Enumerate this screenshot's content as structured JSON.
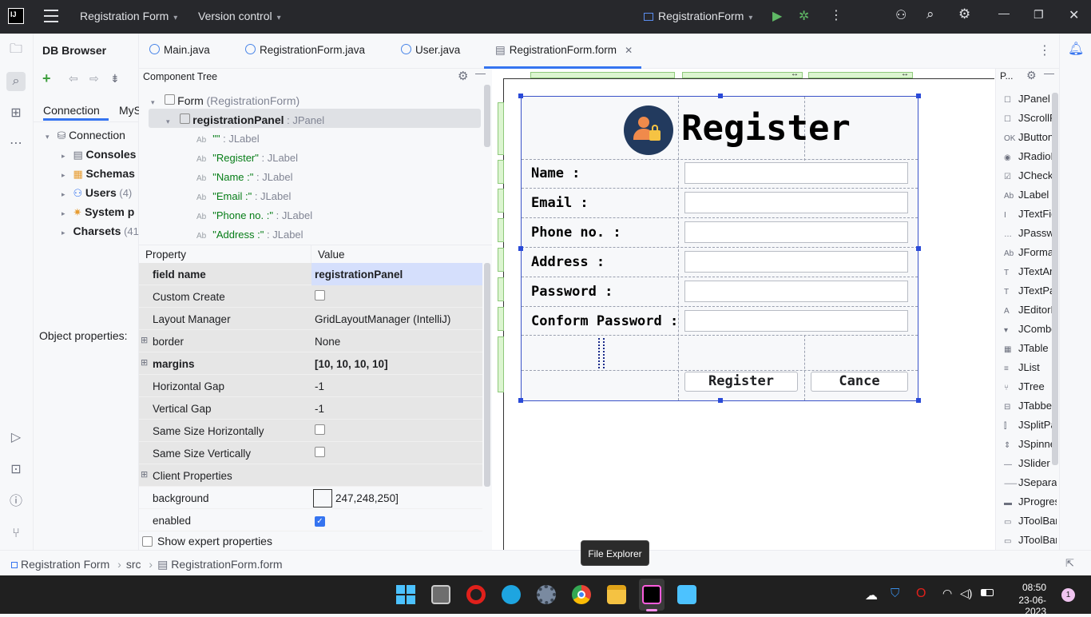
{
  "titlebar": {
    "logo": "IJ",
    "project": "Registration Form",
    "vcs": "Version control",
    "run_config": "RegistrationForm"
  },
  "db_browser": {
    "title": "DB Browser",
    "tabs": [
      "Connection",
      "MyS"
    ],
    "tree": [
      {
        "label": "Connection",
        "count": ""
      },
      {
        "label": "Consoles",
        "count": ""
      },
      {
        "label": "Schemas",
        "count": ""
      },
      {
        "label": "Users",
        "count": "(4)"
      },
      {
        "label": "System p",
        "count": ""
      },
      {
        "label": "Charsets",
        "count": "(41"
      }
    ],
    "object_properties": "Object properties:"
  },
  "editor_tabs": [
    "Main.java",
    "RegistrationForm.java",
    "User.java",
    "RegistrationForm.form"
  ],
  "component_tree": {
    "title": "Component Tree",
    "form_label": "Form",
    "form_class": "(RegistrationForm)",
    "panel_label": "registrationPanel",
    "panel_type": ": JPanel",
    "labels": [
      {
        "name": "\"\"",
        "type": ": JLabel"
      },
      {
        "name": "\"Register\"",
        "type": ": JLabel"
      },
      {
        "name": "\"Name :\"",
        "type": ": JLabel"
      },
      {
        "name": "\"Email :\"",
        "type": ": JLabel"
      },
      {
        "name": "\"Phone no. :\"",
        "type": ": JLabel"
      },
      {
        "name": "\"Address :\"",
        "type": ": JLabel"
      }
    ]
  },
  "properties": {
    "header_property": "Property",
    "header_value": "Value",
    "rows": [
      {
        "name": "field name",
        "value": "registrationPanel"
      },
      {
        "name": "Custom Create",
        "value": ""
      },
      {
        "name": "Layout Manager",
        "value": "GridLayoutManager (IntelliJ)"
      },
      {
        "name": "border",
        "value": "None"
      },
      {
        "name": "margins",
        "value": "[10, 10, 10, 10]"
      },
      {
        "name": "Horizontal Gap",
        "value": "-1"
      },
      {
        "name": "Vertical Gap",
        "value": "-1"
      },
      {
        "name": "Same Size Horizontally",
        "value": ""
      },
      {
        "name": "Same Size Vertically",
        "value": ""
      },
      {
        "name": "Client Properties",
        "value": ""
      },
      {
        "name": "background",
        "value": "247,248,250]"
      },
      {
        "name": "enabled",
        "value": ""
      }
    ],
    "show_expert": "Show expert properties"
  },
  "form": {
    "title": "Register",
    "fields": [
      "Name :",
      "Email :",
      "Phone no. :",
      "Address :",
      "Password :",
      "Conform Password :"
    ],
    "register_button": "Register",
    "cancel_button": "Cance"
  },
  "palette": {
    "title": "P...",
    "items": [
      "JPanel",
      "JScrollPa",
      "JButton",
      "JRadioBu",
      "JCheckBo",
      "JLabel",
      "JTextFielc",
      "JPasswor",
      "JFormatt",
      "JTextArea",
      "JTextPan",
      "JEditorPa",
      "JCombol",
      "JTable",
      "JList",
      "JTree",
      "JTabbedF",
      "JSplitPan",
      "JSpinner",
      "JSlider",
      "JSeparat",
      "JProgres",
      "JToolBar",
      "JToolBar."
    ]
  },
  "breadcrumb": [
    "Registration Form",
    "src",
    "RegistrationForm.form"
  ],
  "tooltip": "File Explorer",
  "taskbar": {
    "time": "08:50",
    "date": "23-06-2023",
    "notif": "1"
  },
  "colors": {
    "accent": "#3574f0",
    "titlebar": "#27282c",
    "taskbar": "#202020",
    "label_green": "#067d17"
  }
}
